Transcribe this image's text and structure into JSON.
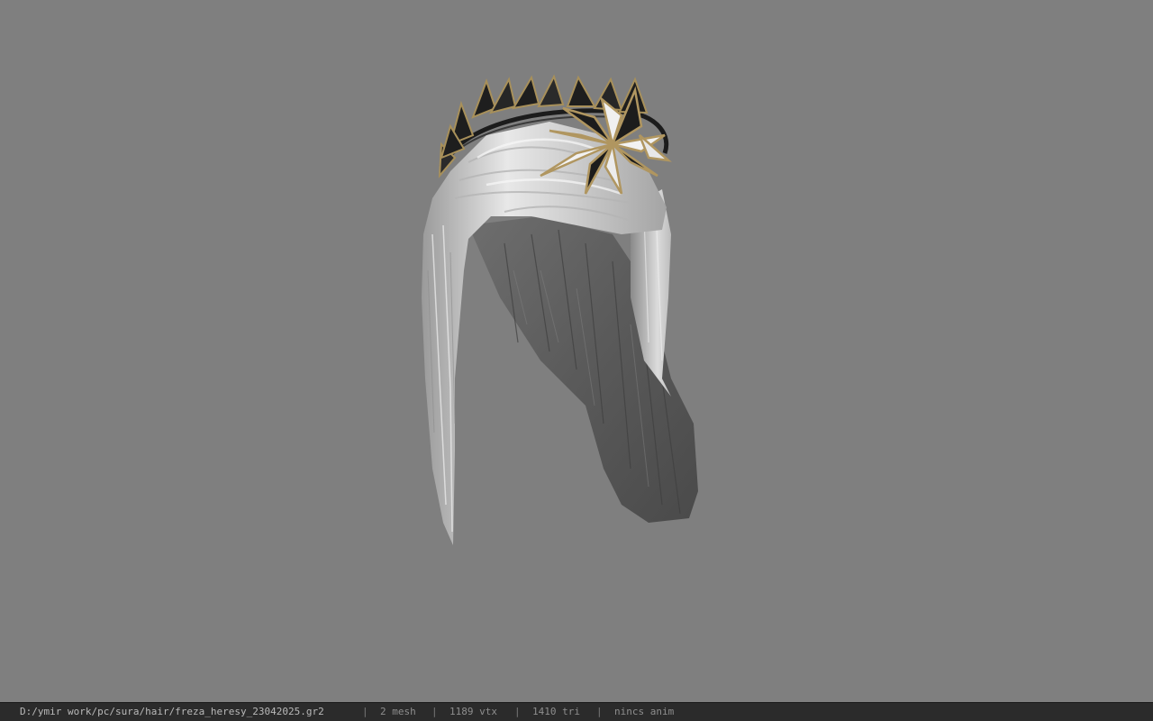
{
  "viewport": {
    "background": "#7f7f7f",
    "model_label": "hair-with-laurel-crown"
  },
  "statusbar": {
    "file_path": "D:/ymir work/pc/sura/hair/freza_heresy_23042025.gr2",
    "separator": "|",
    "mesh": "2 mesh",
    "vertices": "1189 vtx",
    "triangles": "1410 tri",
    "anim": "nincs anim"
  }
}
